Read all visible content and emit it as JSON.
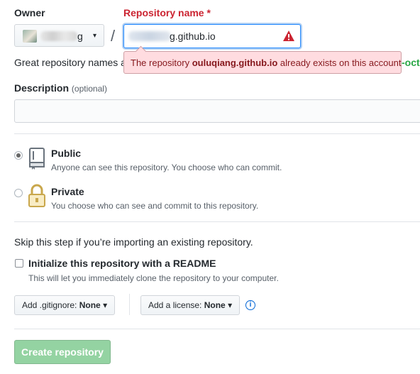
{
  "owner": {
    "label": "Owner",
    "value_suffix": "g",
    "caret": "▾"
  },
  "repo": {
    "label": "Repository name",
    "required_mark": "*",
    "slash": "/",
    "value_suffix": "g.github.io",
    "error_prefix": "The repository ",
    "error_name": "ouluqiang.github.io",
    "error_suffix": " already exists on this account",
    "hint_start": "Great repository names a",
    "hint_cut": "-oct"
  },
  "description": {
    "label": "Description",
    "optional": "(optional)",
    "value": ""
  },
  "visibility": {
    "selected": "Public",
    "options": [
      {
        "title": "Public",
        "note": "Anyone can see this repository. You choose who can commit."
      },
      {
        "title": "Private",
        "note": "You choose who can see and commit to this repository."
      }
    ]
  },
  "init": {
    "skip_text": "Skip this step if you’re importing an existing repository.",
    "checkbox_label": "Initialize this repository with a README",
    "checkbox_note": "This will let you immediately clone the repository to your computer.",
    "checked": false
  },
  "gitignore": {
    "prefix": "Add .gitignore: ",
    "value": "None",
    "caret": "▾"
  },
  "license": {
    "prefix": "Add a license: ",
    "value": "None",
    "caret": "▾"
  },
  "info_glyph": "i",
  "create_button": "Create repository",
  "colors": {
    "required": "#cb2431",
    "error_bg": "#ffdce0",
    "error_text": "#86181d",
    "create_disabled": "#94d3a2",
    "link": "#0366d6"
  }
}
